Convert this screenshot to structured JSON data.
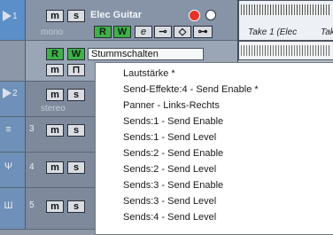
{
  "tracks": [
    {
      "number": "1",
      "name": "Elec Guitar",
      "subtitle": "mono",
      "stummschalten": "Stummschalten"
    },
    {
      "number": "2",
      "subtitle": "stereo"
    },
    {
      "number": "3"
    },
    {
      "number": "4"
    },
    {
      "number": "5"
    }
  ],
  "buttons": {
    "m": "m",
    "s": "s",
    "r": "R",
    "w": "W",
    "e": "e"
  },
  "events": [
    {
      "label": "Take 1 (Elec"
    },
    {
      "label": "Take"
    }
  ],
  "menu": {
    "items": [
      "Lautstärke *",
      "Send-Effekte:4 - Send Enable *",
      "Panner - Links-Rechts",
      "Sends:1 - Send Enable",
      "Sends:1 - Send Level",
      "Sends:2 - Send Enable",
      "Sends:2 - Send Level",
      "Sends:3 - Send Enable",
      "Sends:3 - Send Level",
      "Sends:4 - Send Level"
    ]
  },
  "colors": {
    "track_bg": "#7e8a9c",
    "selected_color": "#5b8fc9",
    "record": "#e63329",
    "rw_green": "#3fb04a"
  }
}
